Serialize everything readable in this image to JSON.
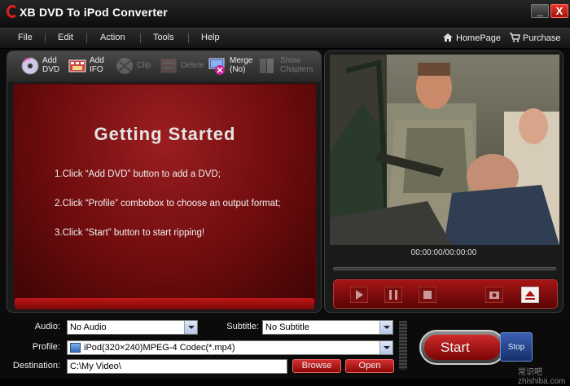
{
  "window": {
    "title": "XB DVD To iPod Converter",
    "minimize_glyph": "_",
    "close_glyph": "X"
  },
  "menu": {
    "items": [
      "File",
      "Edit",
      "Action",
      "Tools",
      "Help"
    ],
    "homepage": "HomePage",
    "purchase": "Purchase"
  },
  "toolbar": {
    "add_dvd": "Add\nDVD",
    "add_ifo": "Add\nIFO",
    "clip": "Clip",
    "delete": "Delete",
    "merge": "Merge\n(No)",
    "show_chapters": "Show\nChapters"
  },
  "getting_started": {
    "title": "Getting  Started",
    "steps": [
      "1.Click “Add DVD” button to add a DVD;",
      "2.Click “Profile” combobox to choose an output format;",
      "3.Click “Start” button to start ripping!"
    ]
  },
  "player": {
    "time": "00:00:00/00:00:00"
  },
  "form": {
    "audio_label": "Audio:",
    "audio_value": "No Audio",
    "subtitle_label": "Subtitle:",
    "subtitle_value": "No Subtitle",
    "profile_label": "Profile:",
    "profile_value": "iPod(320×240)MPEG-4 Codec(*.mp4)",
    "destination_label": "Destination:",
    "destination_value": "C:\\My Video\\",
    "browse": "Browse",
    "open": "Open"
  },
  "actions": {
    "start": "Start",
    "stop": "Stop"
  },
  "watermark": "常识吧 zhishiba.com",
  "colors": {
    "accent_red": "#9b1e20",
    "panel": "#1a1a1a",
    "stop_blue": "#2a4a9a"
  },
  "icons": {
    "home": "home-icon",
    "cart": "cart-icon",
    "add_dvd": "disc-icon",
    "add_ifo": "film-icon",
    "clip": "scissors-disc-icon",
    "delete": "film-delete-icon",
    "merge": "merge-icon",
    "show_chapters": "chapters-icon"
  }
}
